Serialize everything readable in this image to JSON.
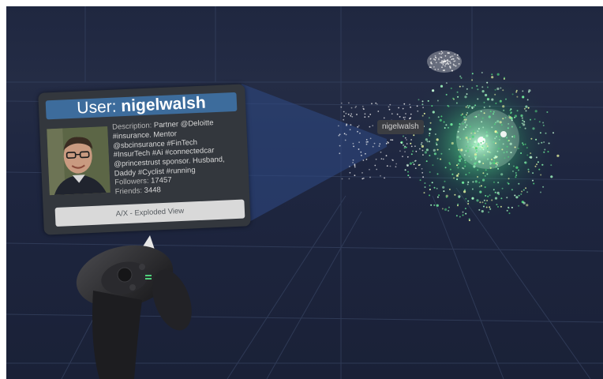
{
  "panel": {
    "title_prefix": "User: ",
    "username": "nigelwalsh",
    "description_label": "Description: ",
    "description_lines": [
      "Partner @Deloitte",
      "#insurance. Mentor",
      "@sbcinsurance #FinTech",
      "#InsurTech #Ai #connectedcar",
      "@princestrust sponsor. Husband,",
      "Daddy #Cyclist #running"
    ],
    "followers_label": "Followers: ",
    "followers": "17457",
    "friends_label": "Friends: ",
    "friends": "3448",
    "button_label": "A/X - Exploded View"
  },
  "graph": {
    "node_label": "nigelwalsh"
  },
  "colors": {
    "panel_bg": "#33373d",
    "title_bar": "#3d6c9c",
    "button_bg": "#d9d9d9",
    "ray": "#2f4a86",
    "node_green": "#6ee79a",
    "node_white": "#f4f4f4"
  },
  "icons": [
    "user-avatar",
    "vr-controller-icon",
    "grid-floor"
  ]
}
